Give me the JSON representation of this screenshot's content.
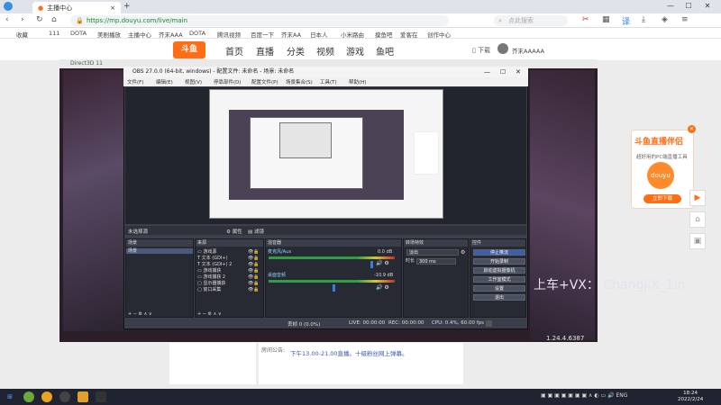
{
  "browser": {
    "tab_title": "主播中心",
    "new_tab_icon": "+",
    "url": "https://mp.douyu.com/live/main",
    "search_placeholder": "点此搜索",
    "window": {
      "min": "—",
      "max": "☐",
      "close": "✕"
    }
  },
  "bookmarks": [
    "收藏",
    "111",
    "DOTA",
    "美剧播放",
    "主播中心",
    "芥末AAA",
    "DOTA",
    "腾讯视频",
    "百度一下",
    "芥末AA",
    "日本人",
    "小米路由",
    "摸鱼吧",
    "爱客在",
    "创作中心"
  ],
  "site": {
    "logo": "斗鱼",
    "nav": [
      "首页",
      "直播",
      "分类",
      "视频",
      "游戏",
      "鱼吧"
    ],
    "download": "下载",
    "username": "芥末AAAAA"
  },
  "stream": {
    "window_title": "Direct3D 11",
    "overlay_text": "上车+VX： ChangjiX_1in",
    "version": "1.24.4.6387"
  },
  "obs": {
    "title": "OBS 27.0.0 (64-bit, windows) - 配置文件: 未命名 - 场景: 未命名",
    "menu": [
      "文件(F)",
      "编辑(E)",
      "视图(V)",
      "停靠部件(D)",
      "配置文件(P)",
      "场景集合(S)",
      "工具(T)",
      "帮助(H)"
    ],
    "scene_bar": {
      "left": "未选择源",
      "props": "属性",
      "filters": "滤镜"
    },
    "panels": {
      "scenes": {
        "title": "场景",
        "items": [
          "场景"
        ]
      },
      "sources": {
        "title": "来源",
        "items": [
          "游戏源",
          "文本 (GDI+)",
          "文本 (GDI+) 2",
          "游戏捕获",
          "游戏捕获 2",
          "显示器捕获",
          "窗口采集"
        ]
      },
      "mixer": {
        "title": "混音器",
        "channels": [
          {
            "name": "麦克风/Aux",
            "db": "0.0 dB"
          },
          {
            "name": "桌面音频",
            "db": "-10.9 dB"
          }
        ]
      },
      "transitions": {
        "title": "转场特效",
        "type": "淡出",
        "duration_label": "时长",
        "duration": "300 ms"
      },
      "controls": {
        "title": "控件",
        "buttons": [
          "停止推流",
          "开始录制",
          "启动虚拟摄像机",
          "工作室模式",
          "设置",
          "退出"
        ]
      }
    },
    "status": {
      "drop": "丢帧 0 (0.0%)",
      "live": "LIVE: 00:00:00",
      "rec": "REC: 00:00:00",
      "cpu": "CPU: 0.4%, 60.00 fps"
    },
    "panel_tools": "+ − ⚙ ∧ ∨"
  },
  "chat": {
    "label": "房间公告:",
    "notice": "下午13.00-21.00直播。十级粉丝网上弹幕。"
  },
  "promo": {
    "title": "斗鱼直播伴侣",
    "subtitle": "超好用的PC端直播工具",
    "mascot": "douyu",
    "button": "立即下载",
    "close": "✕"
  },
  "side_buttons": [
    "▶",
    "⌂",
    "▣"
  ],
  "taskbar": {
    "tray": "ENG",
    "time": "18:24",
    "date": "2022/2/24"
  }
}
